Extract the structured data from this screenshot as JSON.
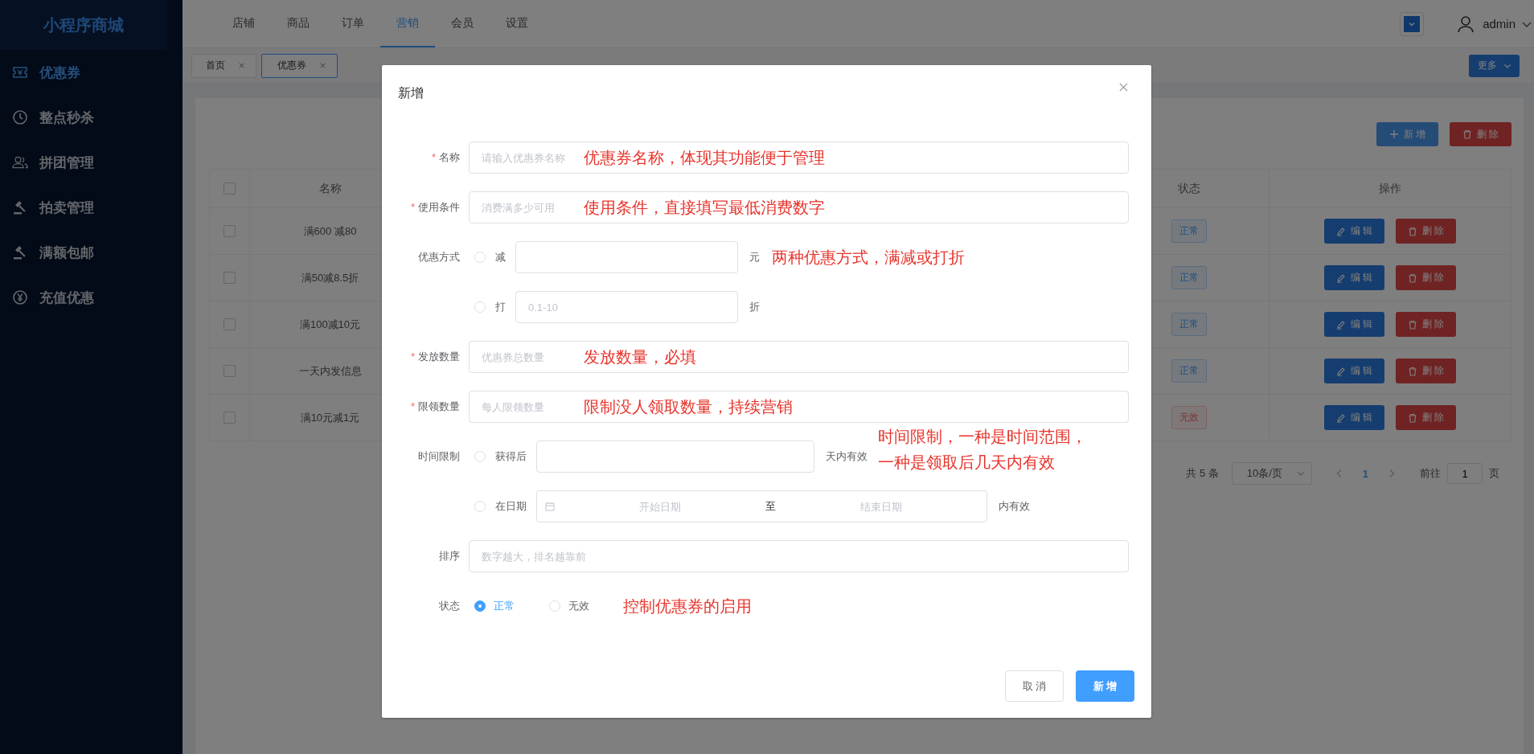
{
  "sidebar": {
    "logo": "小程序商城",
    "items": [
      {
        "label": "优惠券",
        "selected": true
      },
      {
        "label": "整点秒杀",
        "selected": false
      },
      {
        "label": "拼团管理",
        "selected": false
      },
      {
        "label": "拍卖管理",
        "selected": false
      },
      {
        "label": "满额包邮",
        "selected": false
      },
      {
        "label": "充值优惠",
        "selected": false
      }
    ]
  },
  "topbar": {
    "nav": [
      {
        "label": "店铺",
        "selected": false
      },
      {
        "label": "商品",
        "selected": false
      },
      {
        "label": "订单",
        "selected": false
      },
      {
        "label": "营销",
        "selected": true
      },
      {
        "label": "会员",
        "selected": false
      },
      {
        "label": "设置",
        "selected": false
      }
    ],
    "user": "admin"
  },
  "tabs": {
    "items": [
      {
        "label": "首页",
        "selected": false
      },
      {
        "label": "优惠券",
        "selected": true
      }
    ],
    "more": "更多"
  },
  "toolbar": {
    "add": "新 增",
    "delete": "删 除"
  },
  "table": {
    "columns": [
      "名称",
      "状态",
      "操作"
    ],
    "header_checked": false,
    "rows": [
      {
        "checked": false,
        "name": "满600 减80",
        "status": "正常",
        "active": true,
        "edit": "编 辑",
        "delete": "删 除"
      },
      {
        "checked": false,
        "name": "满50减8.5折",
        "status": "正常",
        "active": true,
        "edit": "编 辑",
        "delete": "删 除"
      },
      {
        "checked": false,
        "name": "满100减10元",
        "status": "正常",
        "active": true,
        "edit": "编 辑",
        "delete": "删 除"
      },
      {
        "checked": false,
        "name": "一天内发信息",
        "status": "正常",
        "active": true,
        "edit": "编 辑",
        "delete": "删 除"
      },
      {
        "checked": false,
        "name": "满10元减1元",
        "status": "无效",
        "active": false,
        "edit": "编 辑",
        "delete": "删 除"
      }
    ]
  },
  "pagination": {
    "total": "共 5 条",
    "page_size": "10条/页",
    "pages": [
      {
        "label": "1",
        "selected": true
      }
    ],
    "goto_label": "前往",
    "goto_value": "1",
    "goto_unit": "页"
  },
  "dialog": {
    "title": "新增",
    "required_mark": "*",
    "fields": [
      {
        "kind": "input",
        "label": "名称",
        "required": true,
        "placeholder": "请输入优惠券名称",
        "note": "优惠券名称，体现其功能便于管理"
      },
      {
        "kind": "input",
        "label": "使用条件",
        "required": true,
        "placeholder": "消费满多少可用",
        "note": "使用条件，直接填写最低消费数字"
      },
      {
        "kind": "options",
        "label": "优惠方式",
        "required": false,
        "notes": [
          "两种优惠方式，满减或打折"
        ],
        "options": [
          {
            "kind": "input",
            "label": "减",
            "selected": false,
            "unit": "元"
          },
          {
            "kind": "input",
            "label": "打",
            "selected": false,
            "placeholder": "0.1-10",
            "unit": "折"
          }
        ]
      },
      {
        "kind": "input",
        "label": "发放数量",
        "required": true,
        "placeholder": "优惠券总数量",
        "note": "发放数量，必填"
      },
      {
        "kind": "input",
        "label": "限领数量",
        "required": true,
        "placeholder": "每人限领数量",
        "note": "限制没人领取数量，持续营销"
      },
      {
        "kind": "options",
        "label": "时间限制",
        "required": false,
        "notes": [
          "时间限制，一种是时间范围，",
          "一种是领取后几天内有效"
        ],
        "options": [
          {
            "kind": "input",
            "label": "获得后",
            "selected": false,
            "unit": "天内有效"
          },
          {
            "kind": "range",
            "label": "在日期",
            "selected": false,
            "start_placeholder": "开始日期",
            "separator": "至",
            "end_placeholder": "结束日期",
            "unit": "内有效"
          }
        ]
      },
      {
        "kind": "input",
        "label": "排序",
        "required": false,
        "placeholder": "数字越大，排名越靠前"
      },
      {
        "kind": "radios",
        "label": "状态",
        "required": false,
        "note": "控制优惠券的启用",
        "options": [
          {
            "label": "正常",
            "selected": true
          },
          {
            "label": "无效",
            "selected": false
          }
        ]
      }
    ],
    "cancel": "取 消",
    "submit": "新 增"
  }
}
